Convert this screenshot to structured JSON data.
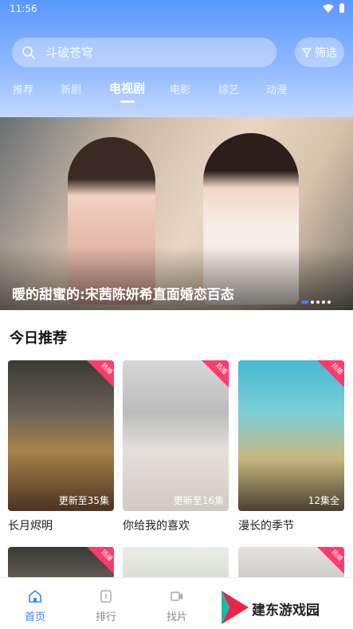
{
  "status_bar": {
    "time": "11:56"
  },
  "search": {
    "placeholder_text": "斗破苍穹"
  },
  "filter": {
    "label": "筛选"
  },
  "tabs": [
    {
      "label": "推荐"
    },
    {
      "label": "新剧"
    },
    {
      "label": "电视剧",
      "active": true
    },
    {
      "label": "电影"
    },
    {
      "label": "综艺"
    },
    {
      "label": "动漫"
    }
  ],
  "banner": {
    "title": "暖的甜蜜的:宋茜陈妍希直面婚恋百态",
    "dots": 5,
    "active_dot": 0
  },
  "section": {
    "title": "今日推荐"
  },
  "cards": [
    {
      "name": "长月烬明",
      "episode": "更新至35集",
      "badge": "热播"
    },
    {
      "name": "你给我的喜欢",
      "episode": "更新至16集",
      "badge": "热播"
    },
    {
      "name": "漫长的季节",
      "episode": "12集全",
      "badge": "热播"
    }
  ],
  "more_badges": [
    "热播",
    "热播"
  ],
  "bottom_nav": [
    {
      "label": "首页",
      "active": true
    },
    {
      "label": "排行"
    },
    {
      "label": "找片"
    }
  ],
  "watermark": {
    "text": "建东游戏园"
  },
  "colors": {
    "accent": "#3b82ff",
    "badge": "#ff3b6b"
  }
}
